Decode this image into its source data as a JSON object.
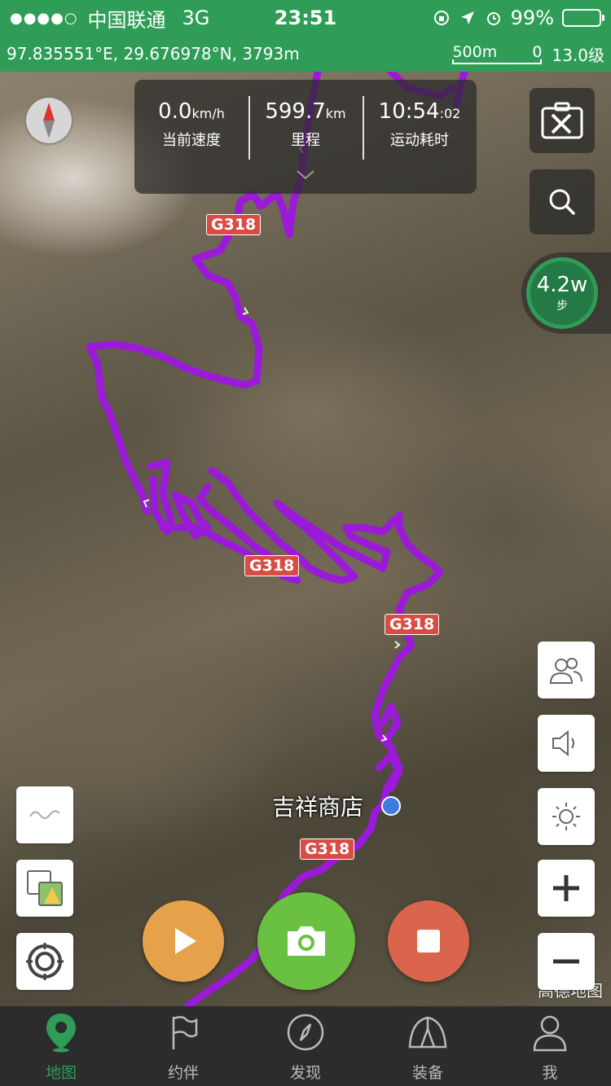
{
  "status_bar": {
    "signal": "●●●●○",
    "carrier": "中国联通",
    "network": "3G",
    "time": "23:51",
    "battery": "99%"
  },
  "location_bar": {
    "coordinates": "97.835551°E, 29.676978°N, 3793m",
    "scale_label": "500m",
    "scale_zero": "0",
    "zoom_level": "13.0级"
  },
  "stats": {
    "speed_value": "0.0",
    "speed_unit": "km/h",
    "speed_label": "当前速度",
    "distance_value": "599.7",
    "distance_unit": "km",
    "distance_label": "里程",
    "time_value": "10:54",
    "time_seconds": ":02",
    "time_label": "运动耗时"
  },
  "steps": {
    "value": "4.2w",
    "unit": "步"
  },
  "map": {
    "road_labels": [
      "G318",
      "G318",
      "G318",
      "G318"
    ],
    "poi_name": "吉祥商店",
    "watermark": "高德地图",
    "route_color": "#9b19d9"
  },
  "tabs": [
    {
      "label": "地图",
      "icon": "map-pin-icon"
    },
    {
      "label": "约伴",
      "icon": "flag-icon"
    },
    {
      "label": "发现",
      "icon": "compass-icon"
    },
    {
      "label": "装备",
      "icon": "tent-icon"
    },
    {
      "label": "我",
      "icon": "person-icon"
    }
  ],
  "colors": {
    "brand": "#2f9d57",
    "play": "#e6a24a",
    "camera": "#6ac041",
    "stop": "#d9654c"
  }
}
